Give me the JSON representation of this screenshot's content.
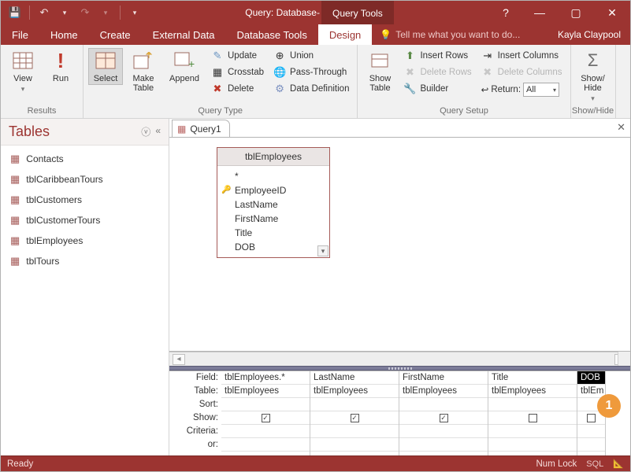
{
  "titlebar": {
    "title": "Query: Database- \\Query.accdb...",
    "context_tab": "Query Tools",
    "user": "Kayla Claypool"
  },
  "tabs": {
    "file": "File",
    "home": "Home",
    "create": "Create",
    "external": "External Data",
    "dbtools": "Database Tools",
    "design": "Design",
    "tellme": "Tell me what you want to do..."
  },
  "ribbon": {
    "results": {
      "label": "Results",
      "view": "View",
      "run": "Run"
    },
    "qtype": {
      "label": "Query Type",
      "select": "Select",
      "make": "Make\nTable",
      "append": "Append",
      "update": "Update",
      "crosstab": "Crosstab",
      "delete": "Delete",
      "union": "Union",
      "passthrough": "Pass-Through",
      "datadef": "Data Definition"
    },
    "qsetup": {
      "label": "Query Setup",
      "showtable": "Show\nTable",
      "insertrows": "Insert Rows",
      "deleterows": "Delete Rows",
      "builder": "Builder",
      "insertcols": "Insert Columns",
      "deletecols": "Delete Columns",
      "return": "Return:",
      "return_val": "All"
    },
    "showhide": {
      "label": "Show/Hide",
      "totals": "Show/\nHide"
    }
  },
  "nav": {
    "title": "Tables",
    "items": [
      "Contacts",
      "tblCaribbeanTours",
      "tblCustomers",
      "tblCustomerTours",
      "tblEmployees",
      "tblTours"
    ]
  },
  "doc": {
    "tabname": "Query1"
  },
  "fieldlist": {
    "title": "tblEmployees",
    "rows": [
      "*",
      "EmployeeID",
      "LastName",
      "FirstName",
      "Title",
      "DOB"
    ],
    "pk_index": 1
  },
  "grid": {
    "rowlabels": [
      "Field:",
      "Table:",
      "Sort:",
      "Show:",
      "Criteria:",
      "or:"
    ],
    "cols": [
      {
        "field": "tblEmployees.*",
        "table": "tblEmployees",
        "show": true
      },
      {
        "field": "LastName",
        "table": "tblEmployees",
        "show": true
      },
      {
        "field": "FirstName",
        "table": "tblEmployees",
        "show": true
      },
      {
        "field": "Title",
        "table": "tblEmployees",
        "show": false
      },
      {
        "field": "DOB",
        "table": "tblEm",
        "show": false,
        "selected": true
      }
    ]
  },
  "status": {
    "left": "Ready",
    "numlock": "Num Lock",
    "sql": "SQL"
  },
  "marker": "1"
}
